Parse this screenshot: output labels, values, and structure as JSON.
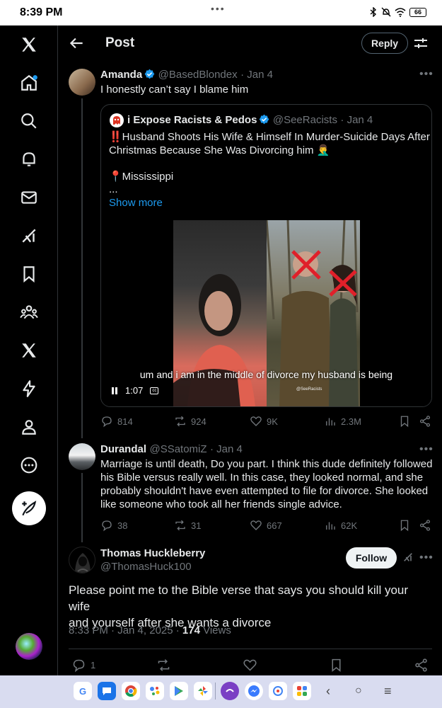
{
  "status_bar": {
    "time": "8:39 PM",
    "battery": "66"
  },
  "header": {
    "title": "Post",
    "reply_label": "Reply"
  },
  "posts": [
    {
      "name": "Amanda",
      "handle": "@BasedBlondex",
      "date": "· Jan 4",
      "text": "I honestly can’t say I blame him",
      "quote": {
        "name": "i Expose Racists & Pedos",
        "handle": "@SeeRacists",
        "date": "· Jan 4",
        "line1": "‼️Husband Shoots His Wife & Himself In Murder-Suicide Days After",
        "line2": "Christmas Because She Was Divorcing him 🤦‍♂️",
        "location": "📍Mississippi",
        "ellipsis": "...",
        "show_more": "Show more",
        "video_caption": "um and i am in the middle of divorce my husband is being",
        "video_time": "1:07",
        "watermark": "@SeeRacists"
      },
      "stats": {
        "replies": "814",
        "reposts": "924",
        "likes": "9K",
        "views": "2.3M"
      }
    },
    {
      "name": "Durandal",
      "handle": "@SSatomiZ",
      "date": "· Jan 4",
      "lines": [
        "Marriage is until death, Do you part. I think this dude definitely followed",
        "his Bible versus really well. In this case, they looked normal, and she",
        "probably shouldn't have even attempted to file for divorce. She looked",
        "like someone who took all her friends single advice."
      ],
      "stats": {
        "replies": "38",
        "reposts": "31",
        "likes": "667",
        "views": "62K"
      }
    }
  ],
  "main_post": {
    "name": "Thomas Huckleberry",
    "handle": "@ThomasHuck100",
    "follow_label": "Follow",
    "line1": "Please point me to the Bible verse that says you should kill your wife",
    "line2": "and yourself after she wants a divorce",
    "timestamp": "8:33 PM · Jan 4, 2025 · ",
    "views_count": "174",
    "views_label": " Views",
    "reply_count": "1"
  },
  "colors": {
    "accent": "#1d9bf0",
    "background": "#000000",
    "muted": "#71767b",
    "border": "#2f3336"
  }
}
